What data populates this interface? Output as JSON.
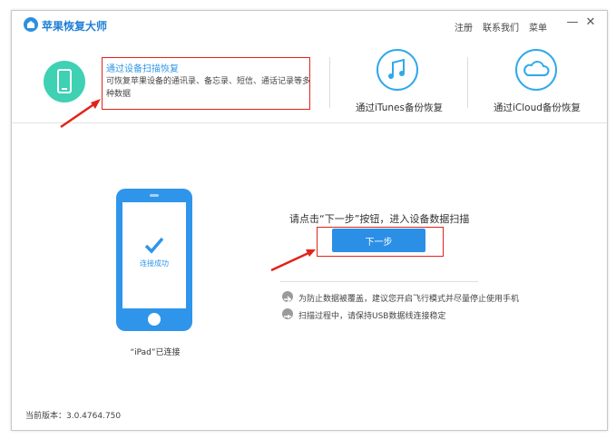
{
  "app": {
    "title": "苹果恢复大师"
  },
  "titlebar": {
    "register": "注册",
    "contact": "联系我们",
    "menu": "菜单",
    "minimize": "—",
    "close": "✕"
  },
  "modes": {
    "device_scan": {
      "title": "通过设备扫描恢复",
      "description": "可恢复苹果设备的通讯录、备忘录、短信、通话记录等多种数据"
    },
    "itunes": {
      "label": "通过iTunes备份恢复"
    },
    "icloud": {
      "label": "通过iCloud备份恢复"
    }
  },
  "device": {
    "connected_label": "连接成功",
    "caption": "“iPad”已连接"
  },
  "main": {
    "hint": "请点击“下一步”按钮，进入设备数据扫描",
    "next_button": "下一步",
    "tips": [
      "为防止数据被覆盖，建议您开启飞行模式并尽量停止使用手机",
      "扫描过程中，请保持USB数据线连接稳定"
    ]
  },
  "footer": {
    "version": "当前版本：3.0.4764.750"
  },
  "colors": {
    "accent": "#2c8fe6",
    "highlight_box": "#e2231a",
    "device_mode": "#3ed1b4"
  }
}
